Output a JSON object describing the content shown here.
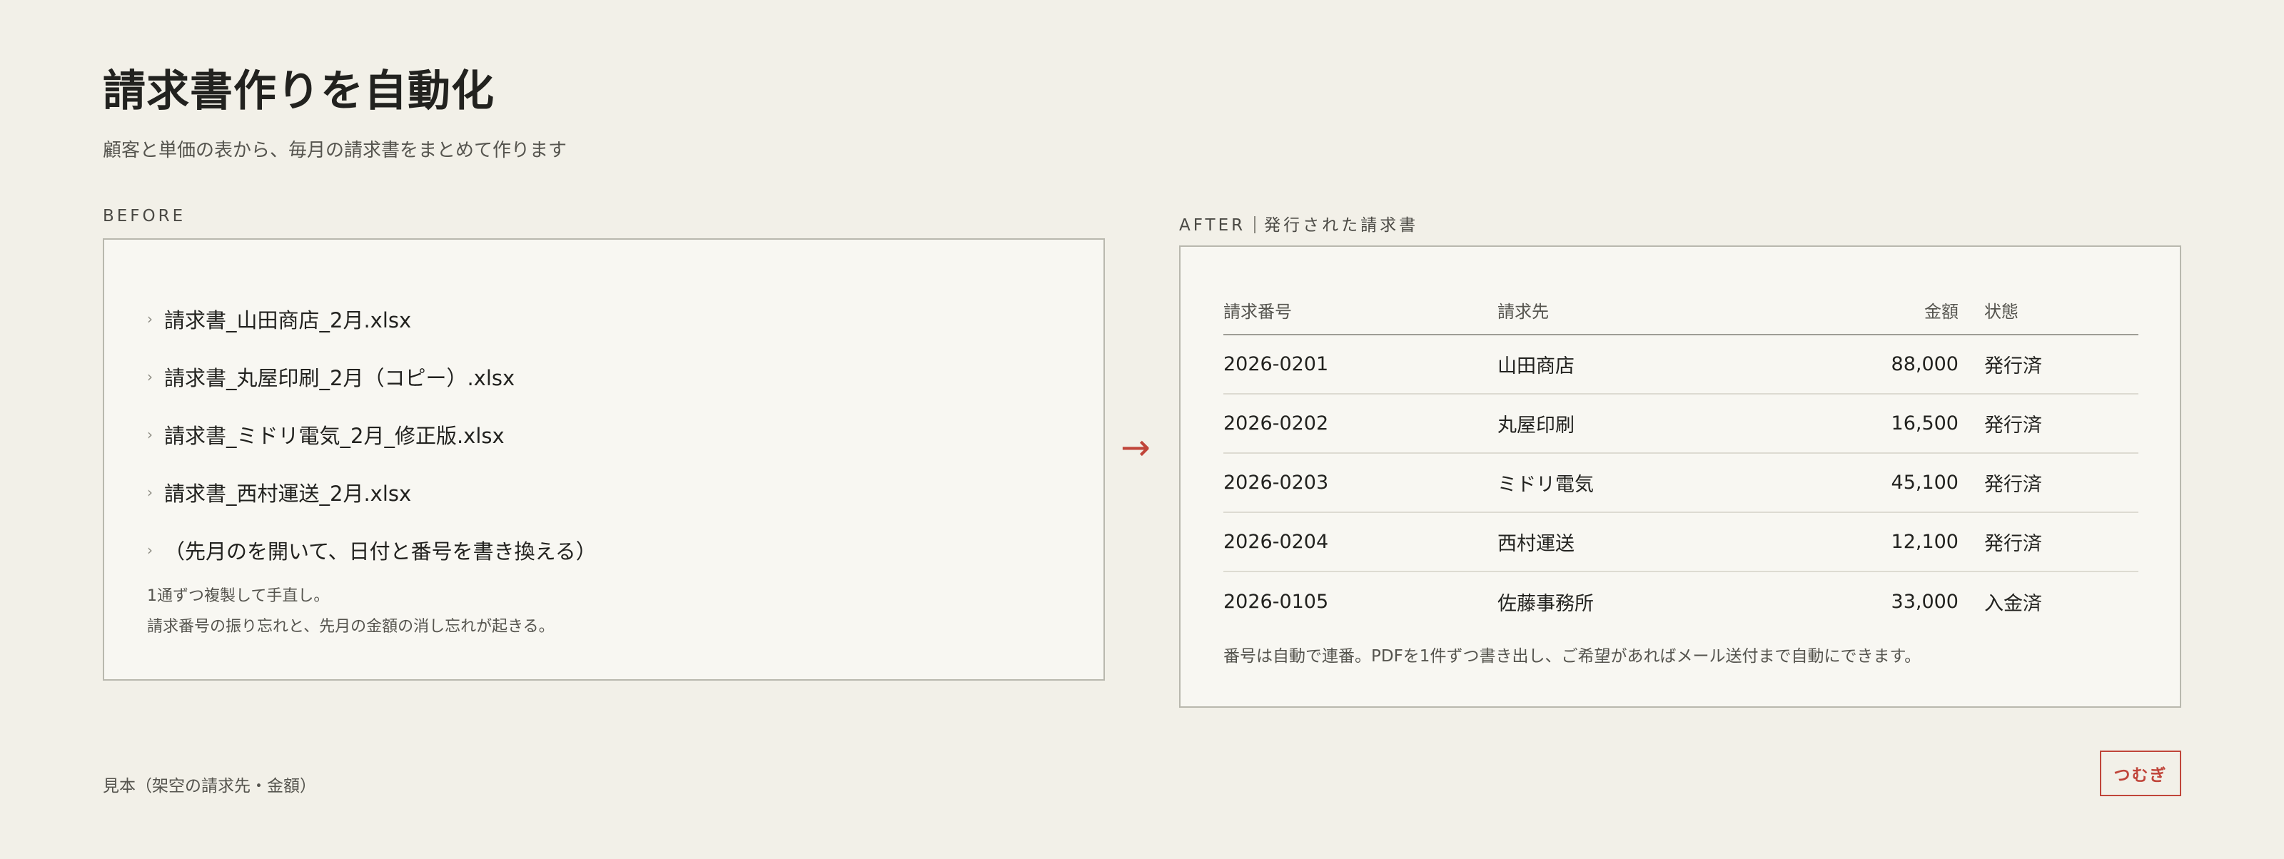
{
  "header": {
    "title": "請求書作りを自動化",
    "subtitle": "顧客と単価の表から、毎月の請求書をまとめて作ります"
  },
  "before": {
    "label": "BEFORE",
    "files": [
      "請求書_山田商店_2月.xlsx",
      "請求書_丸屋印刷_2月（コピー）.xlsx",
      "請求書_ミドリ電気_2月_修正版.xlsx",
      "請求書_西村運送_2月.xlsx",
      "（先月のを開いて、日付と番号を書き換える）"
    ],
    "note_line1": "1通ずつ複製して手直し。",
    "note_line2": "請求番号の振り忘れと、先月の金額の消し忘れが起きる。"
  },
  "arrow": "→",
  "after": {
    "label": "AFTER",
    "label_sub": "発行された請求書",
    "columns": [
      "請求番号",
      "請求先",
      "金額",
      "状態"
    ],
    "rows": [
      [
        "2026-0201",
        "山田商店",
        "88,000",
        "発行済"
      ],
      [
        "2026-0202",
        "丸屋印刷",
        "16,500",
        "発行済"
      ],
      [
        "2026-0203",
        "ミドリ電気",
        "45,100",
        "発行済"
      ],
      [
        "2026-0204",
        "西村運送",
        "12,100",
        "発行済"
      ],
      [
        "2026-0105",
        "佐藤事務所",
        "33,000",
        "入金済"
      ]
    ],
    "note": "番号は自動で連番。PDFを1件ずつ書き出し、ご希望があればメール送付まで自動にできます。"
  },
  "footer": {
    "sample_note": "見本（架空の請求先・金額）",
    "brand": "つむぎ"
  },
  "colors": {
    "background": "#f2f0e8",
    "panel": "#f8f7f2",
    "accent": "#c0453a",
    "text": "#22221f"
  },
  "icons": {
    "list_bullet": "chevron-right-icon",
    "transition": "arrow-right-icon"
  }
}
